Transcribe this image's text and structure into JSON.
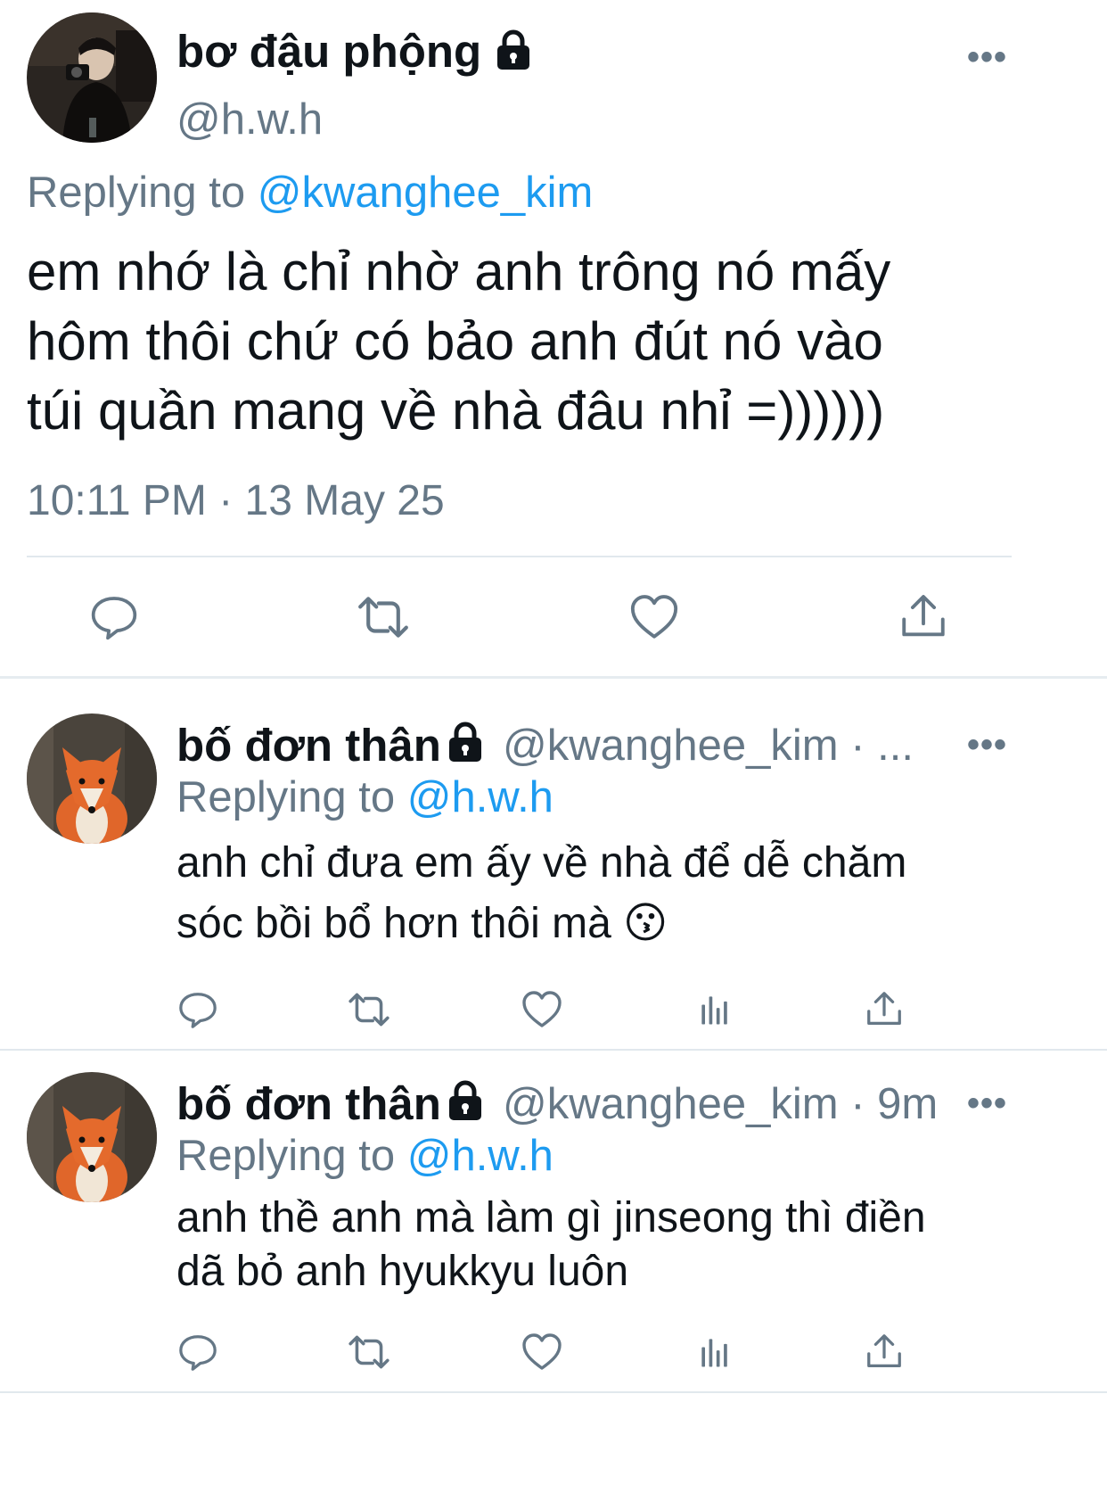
{
  "main_tweet": {
    "display_name": "bơ đậu phộng",
    "handle": "@h.w.h",
    "replying_prefix": "Replying to",
    "replying_to": "@kwanghee_kim",
    "text_lines": [
      "em nhớ là chỉ nhờ anh trông nó mấy",
      "hôm thôi chứ có bảo anh đút nó vào",
      "túi quần mang về nhà đâu nhỉ =))))))"
    ],
    "timestamp": "10:11 PM · 13 May 25",
    "actions": [
      "reply-icon",
      "retweet-icon",
      "like-icon",
      "share-icon"
    ]
  },
  "replies": [
    {
      "display_name": "bố đơn thân",
      "handle_time": "@kwanghee_kim · ...",
      "replying_prefix": "Replying to",
      "replying_to": "@h.w.h",
      "text_lines": [
        "anh chỉ đưa em ấy về nhà để dễ chăm",
        "sóc bồi bổ hơn thôi mà 😗"
      ],
      "actions": [
        "reply-icon",
        "retweet-icon",
        "like-icon",
        "analytics-icon",
        "share-icon"
      ]
    },
    {
      "display_name": "bố đơn thân",
      "handle_time": "@kwanghee_kim · 9m",
      "replying_prefix": "Replying to",
      "replying_to": "@h.w.h",
      "text_lines": [
        "anh thề anh mà làm gì jinseong thì điền",
        "dã bỏ anh hyukkyu luôn"
      ],
      "actions": [
        "reply-icon",
        "retweet-icon",
        "like-icon",
        "analytics-icon",
        "share-icon"
      ]
    }
  ],
  "colors": {
    "text": "#0f1419",
    "muted": "#657786",
    "link": "#1d9bf0",
    "divider": "#e1e8ed"
  }
}
